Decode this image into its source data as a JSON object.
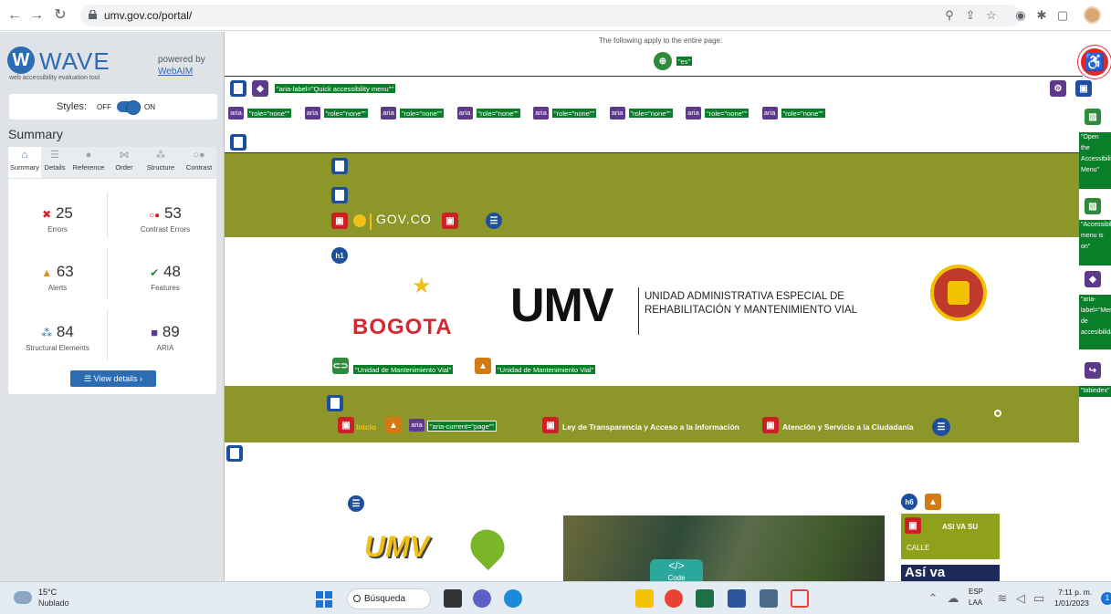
{
  "browser": {
    "url": "umv.gov.co/portal/"
  },
  "wave": {
    "logo": "WAVE",
    "tagline": "web accessibility evaluation tool",
    "powered_by": "powered by",
    "webaim": "WebAIM",
    "styles_label": "Styles:",
    "styles_off": "OFF",
    "styles_on": "ON",
    "summary_title": "Summary",
    "tabs": [
      "Summary",
      "Details",
      "Reference",
      "Order",
      "Structure",
      "Contrast"
    ],
    "stats": {
      "errors": {
        "num": "25",
        "label": "Errors",
        "icon": "x-box-icon",
        "color": "#d3242c"
      },
      "contrast": {
        "num": "53",
        "label": "Contrast Errors",
        "icon": "contrast-icon",
        "color": "#d3242c"
      },
      "alerts": {
        "num": "63",
        "label": "Alerts",
        "icon": "warning-icon",
        "color": "#e0901a"
      },
      "features": {
        "num": "48",
        "label": "Features",
        "icon": "check-icon",
        "color": "#2f8a3a"
      },
      "structural": {
        "num": "84",
        "label": "Structural Elements",
        "icon": "hierarchy-icon",
        "color": "#2b6cb3"
      },
      "aria": {
        "num": "89",
        "label": "ARIA",
        "icon": "aria-icon",
        "color": "#5d3a8a"
      }
    },
    "view_details": "View details ›"
  },
  "page": {
    "apply_text": "The following apply to the entire page:",
    "lang_tag": "\"es\"",
    "quick_menu_tag": "\"aria-label=\"Quick accessibility menu\"\"",
    "role_none": "\"role=\"none\"\"",
    "aria": "aria",
    "gov": "GOV.CO",
    "h1": "h1",
    "bogota": "BOGOTA",
    "umv": "UMV",
    "umv_sub1": "UNIDAD ADMINISTRATIVA ESPECIAL DE",
    "umv_sub2": "REHABILITACIÓN Y MANTENIMIENTO VIAL",
    "alt_tag1": "\"Unidad de Mantenimiento Vial\"",
    "alt_tag2": "\"Unidad de Mantenimiento Vial\"",
    "nav": {
      "inicio": "Inicio",
      "aria_current": "\"aria-current=\"page\"\"",
      "transparencia": "Ley de Transparencia y Acceso a la Información",
      "atencion": "Atención y Servicio a la Ciudadanía"
    },
    "side_tags": [
      "\"Open the Accessibility Menu\"",
      "\"Accessibility menu is on\"",
      "\"aria-label=\"Menú de accesibilidad\"\"",
      "\"tabindex\""
    ],
    "h6": "h6",
    "hero_side": "ASI VA SU",
    "hero_side2": "CALLE",
    "hero_asi": "Así va",
    "hero_logo": "UMV",
    "code": "</>",
    "code_label": "Code"
  },
  "taskbar": {
    "temp": "15°C",
    "condition": "Nublado",
    "search": "Búsqueda",
    "lang1": "ESP",
    "lang2": "LAA",
    "time": "7:11 p. m.",
    "date": "1/01/2023",
    "notif": "1"
  }
}
